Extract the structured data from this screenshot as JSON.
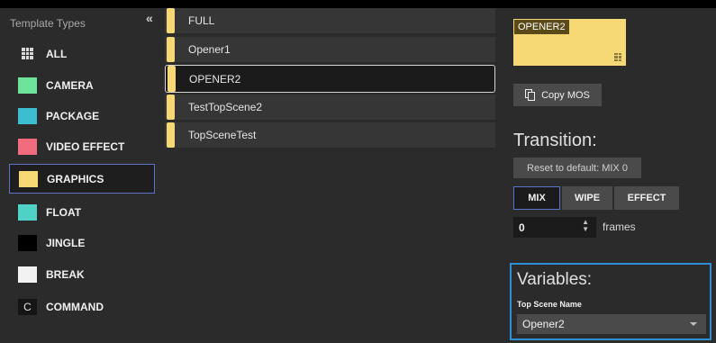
{
  "sidebar": {
    "title": "Template Types",
    "collapse_icon": "«",
    "items": [
      {
        "label": "ALL",
        "icon": "grid-icon"
      },
      {
        "label": "CAMERA",
        "color": "#6ee39b"
      },
      {
        "label": "PACKAGE",
        "color": "#3dbdd1"
      },
      {
        "label": "VIDEO EFFECT",
        "color": "#f06c7e"
      },
      {
        "label": "GRAPHICS",
        "color": "#f6d975",
        "selected": true
      },
      {
        "label": "FLOAT",
        "color": "#4fd1c5"
      },
      {
        "label": "JINGLE",
        "color": "#000000"
      },
      {
        "label": "BREAK",
        "color": "#f2f2f2"
      },
      {
        "label": "COMMAND",
        "icon_text": "C"
      }
    ]
  },
  "templates": {
    "color": "#f6d975",
    "items": [
      {
        "label": "FULL"
      },
      {
        "label": "Opener1"
      },
      {
        "label": "OPENER2",
        "selected": true
      },
      {
        "label": "TestTopScene2"
      },
      {
        "label": "TopSceneTest"
      }
    ]
  },
  "details": {
    "preview_label": "OPENER2",
    "copy_button": "Copy MOS",
    "transition_title": "Transition:",
    "reset_button": "Reset to default: MIX 0",
    "transition_options": [
      {
        "label": "MIX",
        "selected": true
      },
      {
        "label": "WIPE"
      },
      {
        "label": "EFFECT"
      }
    ],
    "frames_value": "0",
    "frames_label": "frames",
    "variables_title": "Variables:",
    "variable_name": "Top Scene Name",
    "variable_value": "Opener2"
  }
}
